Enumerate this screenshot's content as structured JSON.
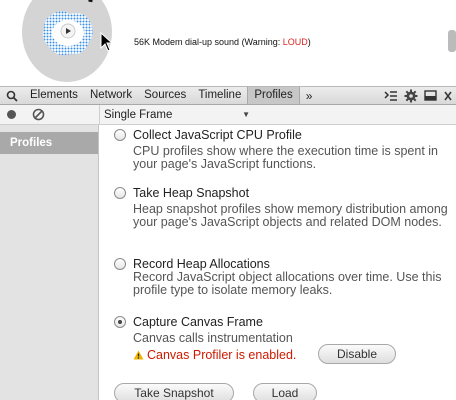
{
  "page": {
    "sound_text": "56K Modem dial-up sound (Warning: ",
    "sound_warning": "LOUD",
    "sound_suffix": ")"
  },
  "devtools": {
    "tabs": [
      {
        "label": "Elements"
      },
      {
        "label": "Network"
      },
      {
        "label": "Sources"
      },
      {
        "label": "Timeline"
      },
      {
        "label": "Profiles"
      }
    ],
    "active_tab": "Profiles",
    "more_tabs": "»",
    "frame_select": "Single Frame"
  },
  "sidebar": {
    "items": [
      {
        "label": "Profiles"
      }
    ]
  },
  "profiles": {
    "options": [
      {
        "title": "Collect JavaScript CPU Profile",
        "description": "CPU profiles show where the execution time is spent in your page's JavaScript functions.",
        "checked": false
      },
      {
        "title": "Take Heap Snapshot",
        "description": "Heap snapshot profiles show memory distribution among your page's JavaScript objects and related DOM nodes.",
        "checked": false
      },
      {
        "title": "Record Heap Allocations",
        "description": "Record JavaScript object allocations over time. Use this profile type to isolate memory leaks.",
        "checked": false
      },
      {
        "title": "Capture Canvas Frame",
        "description": "Canvas calls instrumentation",
        "checked": true
      }
    ],
    "canvas_warning": "Canvas Profiler is enabled.",
    "disable_label": "Disable",
    "take_snapshot_label": "Take Snapshot",
    "load_label": "Load"
  },
  "colors": {
    "warning_red": "#cc1a00",
    "sidebar_selected": "#a9a9a9"
  }
}
